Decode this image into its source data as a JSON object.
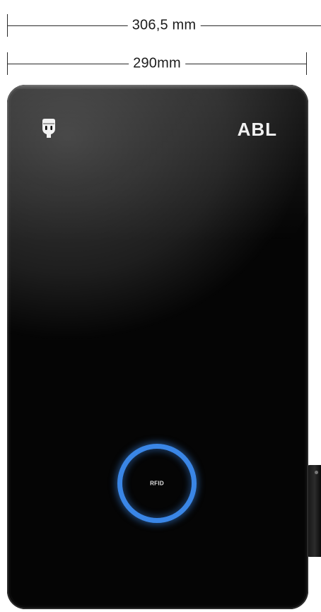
{
  "dimensions": {
    "outer_width_label": "306,5 mm",
    "inner_width_label": "290mm"
  },
  "device": {
    "brand": "ABL",
    "rfid_label": "RFID",
    "rfid_ring_color": "#3a86e6",
    "body_color": "#050505",
    "icons": [
      "plug-icon"
    ]
  }
}
